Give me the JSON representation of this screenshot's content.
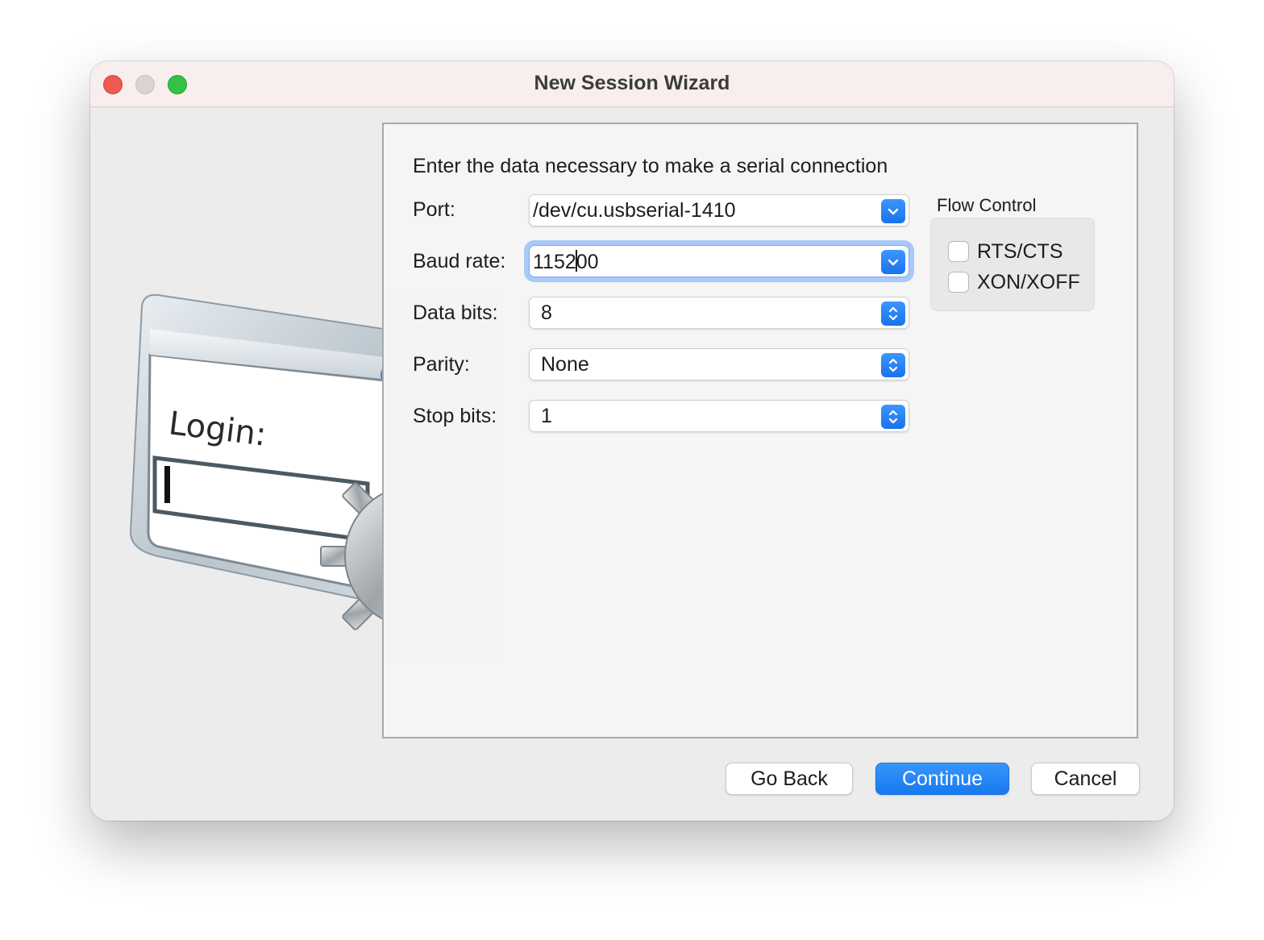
{
  "window": {
    "title": "New Session Wizard"
  },
  "illustration": {
    "login_label": "Login:"
  },
  "form": {
    "heading": "Enter the data necessary to make a serial connection",
    "port": {
      "label": "Port:",
      "value": "/dev/cu.usbserial-1410"
    },
    "baud_rate": {
      "label": "Baud rate:",
      "value_before_caret": "1152",
      "value_after_caret": "00"
    },
    "data_bits": {
      "label": "Data bits:",
      "value": "8"
    },
    "parity": {
      "label": "Parity:",
      "value": "None"
    },
    "stop_bits": {
      "label": "Stop bits:",
      "value": "1"
    }
  },
  "flow_control": {
    "title": "Flow Control",
    "options": [
      {
        "label": "RTS/CTS",
        "checked": false
      },
      {
        "label": "XON/XOFF",
        "checked": false
      }
    ]
  },
  "buttons": {
    "go_back": "Go Back",
    "continue": "Continue",
    "cancel": "Cancel"
  },
  "colors": {
    "accent": "#1a7cf0",
    "close": "#ee5a52",
    "minimize": "#d9d4d4",
    "zoom": "#35c146"
  }
}
